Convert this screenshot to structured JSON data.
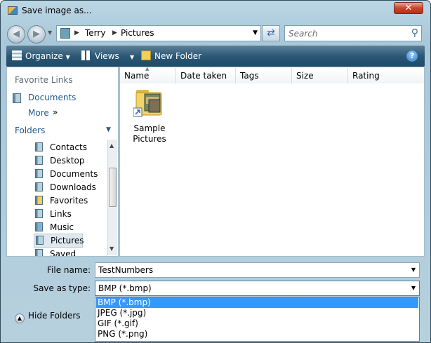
{
  "window": {
    "title": "Save image as...",
    "close_label": "✕"
  },
  "navigation": {
    "back_icon": "back-arrow-icon",
    "forward_icon": "forward-arrow-icon",
    "breadcrumbs": [
      "Terry",
      "Pictures"
    ],
    "search_placeholder": "Search"
  },
  "toolbar": {
    "organize_label": "Organize",
    "views_label": "Views",
    "new_folder_label": "New Folder",
    "help_label": "?"
  },
  "nav_pane": {
    "favorite_links_heading": "Favorite Links",
    "documents_link": "Documents",
    "more_link": "More",
    "more_chevrons": "»",
    "folders_heading": "Folders",
    "tree_items": [
      {
        "label": "Contacts"
      },
      {
        "label": "Desktop"
      },
      {
        "label": "Documents"
      },
      {
        "label": "Downloads"
      },
      {
        "label": "Favorites"
      },
      {
        "label": "Links"
      },
      {
        "label": "Music"
      },
      {
        "label": "Pictures",
        "selected": true
      },
      {
        "label": "Saved Games"
      }
    ]
  },
  "file_pane": {
    "columns": [
      "Name",
      "Date taken",
      "Tags",
      "Size",
      "Rating"
    ],
    "items": [
      {
        "name_line1": "Sample",
        "name_line2": "Pictures",
        "icon": "folder-shortcut-icon"
      }
    ]
  },
  "bottom": {
    "file_name_label": "File name:",
    "file_name_value": "TestNumbers",
    "save_type_label": "Save as type:",
    "save_type_value": "BMP (*.bmp)",
    "type_options": [
      "BMP (*.bmp)",
      "JPEG (*.jpg)",
      "GIF (*.gif)",
      "PNG (*.png)"
    ],
    "selected_option_index": 0,
    "hide_folders_label": "Hide Folders"
  },
  "colors": {
    "toolbar": "#2b5877",
    "selection": "#3399ff",
    "link": "#1f5a90"
  }
}
